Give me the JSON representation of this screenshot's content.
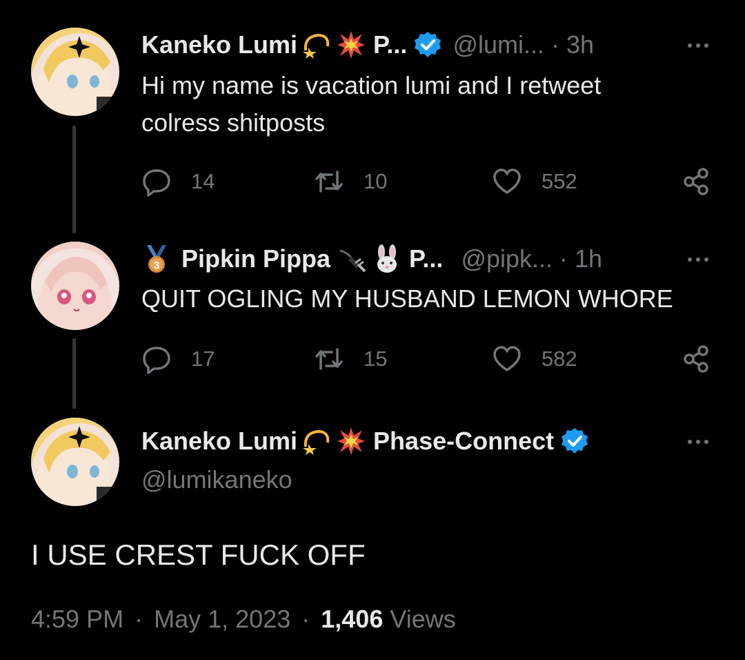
{
  "thread": [
    {
      "display_name": "Kaneko Lumi",
      "emojis": [
        "dizzy-emoji",
        "collision-emoji"
      ],
      "affiliation": "P...",
      "verified": true,
      "handle": "@lumi...",
      "time": "3h",
      "text": "Hi my name is vacation lumi and I retweet\ncolress shitposts",
      "replies": "14",
      "retweets": "10",
      "likes": "552"
    },
    {
      "badge": "bronze-medal-3-emoji",
      "display_name": "Pipkin Pippa",
      "emojis": [
        "plug-emoji",
        "rabbit-face-emoji"
      ],
      "affiliation": "P...",
      "verified": false,
      "handle": "@pipk...",
      "time": "1h",
      "text": "QUIT OGLING MY HUSBAND LEMON WHORE",
      "replies": "17",
      "retweets": "15",
      "likes": "582"
    }
  ],
  "main": {
    "display_name": "Kaneko Lumi",
    "emojis": [
      "dizzy-emoji",
      "collision-emoji"
    ],
    "affiliation": "Phase-Connect",
    "verified": true,
    "handle": "@lumikaneko",
    "text": "I USE CREST FUCK OFF",
    "time": "4:59 PM",
    "date": "May 1, 2023",
    "views_count": "1,406",
    "views_label": "Views"
  },
  "separator": "·",
  "colors": {
    "background": "#000000",
    "text": "#e7e9ea",
    "secondary": "#71767b",
    "verified": "#1d9bf0",
    "thread_line": "#333639"
  }
}
